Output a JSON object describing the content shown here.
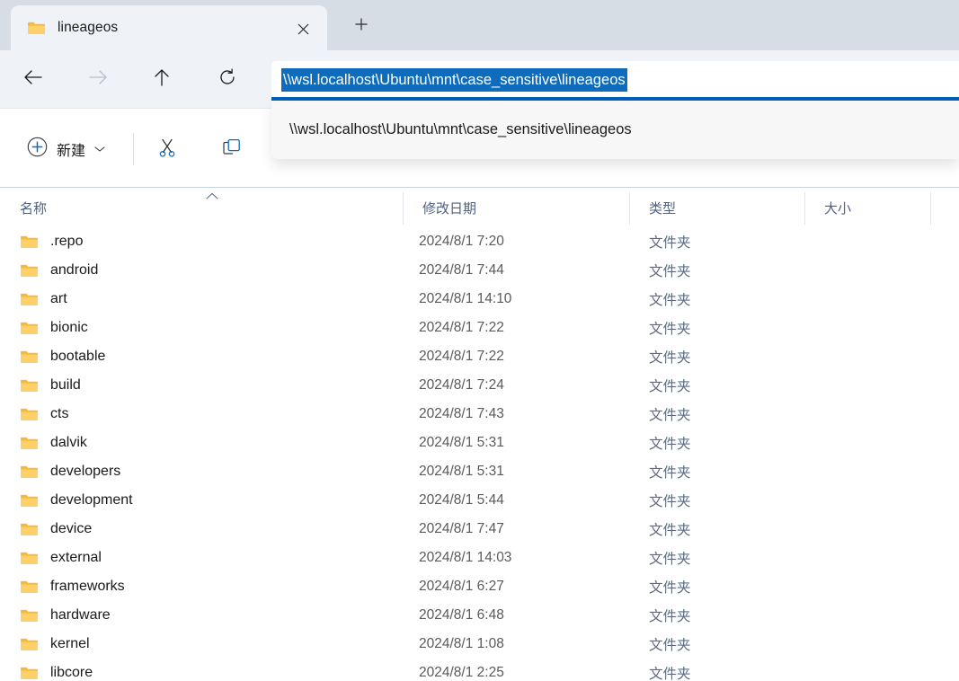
{
  "window": {
    "tab": {
      "title": "lineageos",
      "folder_icon": "folder-icon",
      "close_icon": "close-icon"
    },
    "new_tab_icon": "plus-icon"
  },
  "navbar": {
    "back_icon": "arrow-left-icon",
    "forward_icon": "arrow-right-icon",
    "up_icon": "arrow-up-icon",
    "refresh_icon": "refresh-icon"
  },
  "address": {
    "value": "\\\\wsl.localhost\\Ubuntu\\mnt\\case_sensitive\\lineageos",
    "selected": true,
    "suggestion": "\\\\wsl.localhost\\Ubuntu\\mnt\\case_sensitive\\lineageos",
    "focus_color": "#005fb8",
    "selection_color": "#0f6cbd"
  },
  "toolbar": {
    "new_label": "新建",
    "new_icon": "plus-circle-icon",
    "new_chevron_icon": "chevron-down-icon",
    "cut_icon": "scissors-icon",
    "copy_icon": "copy-icon",
    "accent_color": "#0f6cbd"
  },
  "columns": {
    "name": "名称",
    "date": "修改日期",
    "type": "类型",
    "size": "大小",
    "sort_indicator": "⌃",
    "sort_column": "名称",
    "sort_direction": "ascending",
    "header_color": "#4f6182"
  },
  "files": [
    {
      "name": ".repo",
      "date": "2024/8/1 7:20",
      "type": "文件夹",
      "size": ""
    },
    {
      "name": "android",
      "date": "2024/8/1 7:44",
      "type": "文件夹",
      "size": ""
    },
    {
      "name": "art",
      "date": "2024/8/1 14:10",
      "type": "文件夹",
      "size": ""
    },
    {
      "name": "bionic",
      "date": "2024/8/1 7:22",
      "type": "文件夹",
      "size": ""
    },
    {
      "name": "bootable",
      "date": "2024/8/1 7:22",
      "type": "文件夹",
      "size": ""
    },
    {
      "name": "build",
      "date": "2024/8/1 7:24",
      "type": "文件夹",
      "size": ""
    },
    {
      "name": "cts",
      "date": "2024/8/1 7:43",
      "type": "文件夹",
      "size": ""
    },
    {
      "name": "dalvik",
      "date": "2024/8/1 5:31",
      "type": "文件夹",
      "size": ""
    },
    {
      "name": "developers",
      "date": "2024/8/1 5:31",
      "type": "文件夹",
      "size": ""
    },
    {
      "name": "development",
      "date": "2024/8/1 5:44",
      "type": "文件夹",
      "size": ""
    },
    {
      "name": "device",
      "date": "2024/8/1 7:47",
      "type": "文件夹",
      "size": ""
    },
    {
      "name": "external",
      "date": "2024/8/1 14:03",
      "type": "文件夹",
      "size": ""
    },
    {
      "name": "frameworks",
      "date": "2024/8/1 6:27",
      "type": "文件夹",
      "size": ""
    },
    {
      "name": "hardware",
      "date": "2024/8/1 6:48",
      "type": "文件夹",
      "size": ""
    },
    {
      "name": "kernel",
      "date": "2024/8/1 1:08",
      "type": "文件夹",
      "size": ""
    },
    {
      "name": "libcore",
      "date": "2024/8/1 2:25",
      "type": "文件夹",
      "size": ""
    }
  ]
}
